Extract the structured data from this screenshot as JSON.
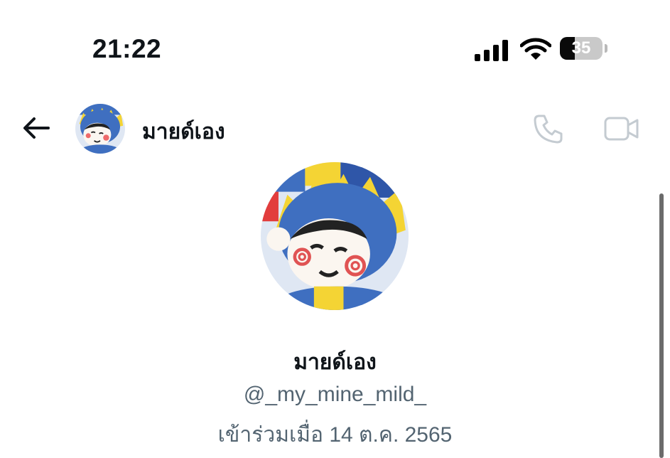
{
  "status_bar": {
    "time": "21:22",
    "battery_level": "35",
    "battery_fraction": 0.35,
    "icons": [
      "cellular-signal-icon",
      "wifi-icon",
      "battery-icon"
    ]
  },
  "header": {
    "name": "มายด์เอง",
    "icons": [
      "back-arrow-icon",
      "phone-icon",
      "video-camera-icon"
    ],
    "icon_color": "#c4cbd1"
  },
  "profile": {
    "name": "มายด์เอง",
    "handle": "@_my_mine_mild_",
    "joined": "เข้าร่วมเมื่อ 14 ต.ค. 2565"
  },
  "colors": {
    "text_primary": "#0f1419",
    "text_secondary": "#536471",
    "avatar_blue": "#3f6fc0",
    "avatar_yellow": "#f4d434"
  }
}
